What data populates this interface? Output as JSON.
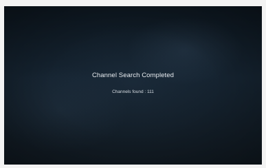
{
  "status": {
    "title": "Channel Search Completed",
    "channels_label": "Channels found",
    "channels_count": "111",
    "channels_text": "Channels found : 111"
  },
  "colors": {
    "screen_background": "#121d27",
    "text_primary": "#e9edf1",
    "text_secondary": "#d7dde3"
  }
}
